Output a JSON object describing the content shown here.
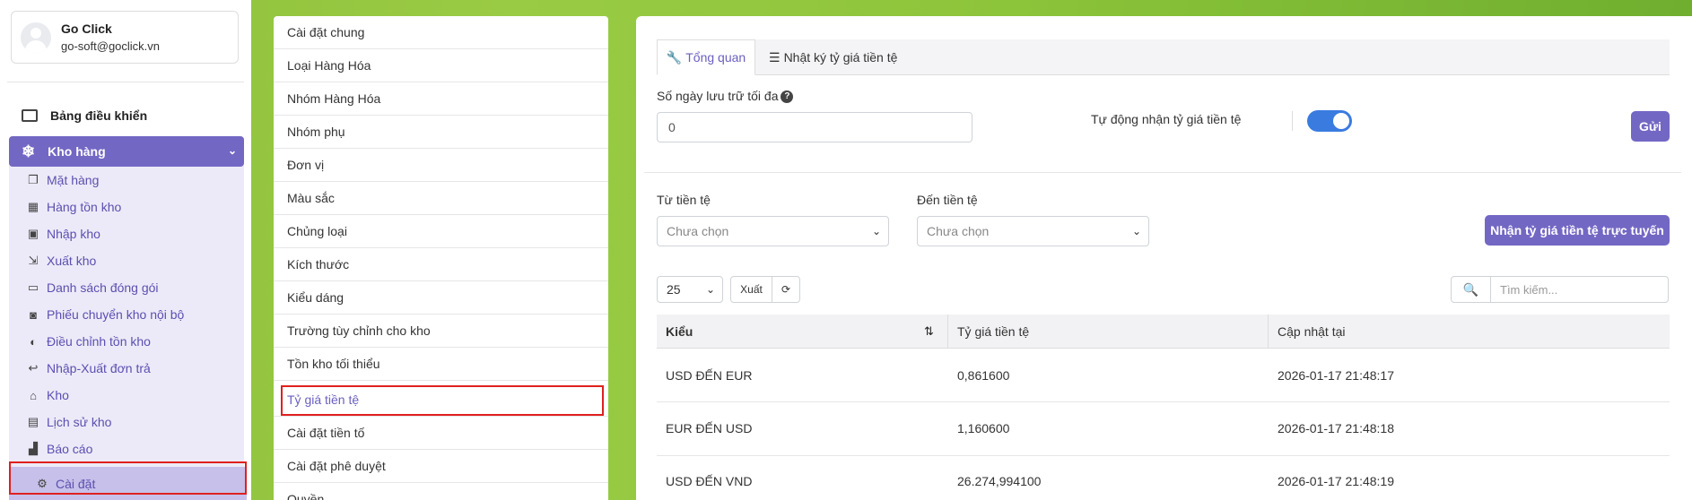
{
  "user": {
    "name": "Go Click",
    "email": "go-soft@goclick.vn"
  },
  "sidebar": {
    "dashboard": "Bảng điều khiển",
    "kho_hang": "Kho hàng",
    "items": [
      {
        "label": "Mặt hàng",
        "icon": "copy-icon"
      },
      {
        "label": "Hàng tồn kho",
        "icon": "boxes-icon"
      },
      {
        "label": "Nhập kho",
        "icon": "inbox-icon"
      },
      {
        "label": "Xuất kho",
        "icon": "export-icon"
      },
      {
        "label": "Danh sách đóng gói",
        "icon": "tray-icon"
      },
      {
        "label": "Phiếu chuyển kho nội bộ",
        "icon": "rss-icon"
      },
      {
        "label": "Điều chỉnh tồn kho",
        "icon": "half-circle-icon"
      },
      {
        "label": "Nhập-Xuất đơn trả",
        "icon": "reply-icon"
      },
      {
        "label": "Kho",
        "icon": "home-icon"
      },
      {
        "label": "Lịch sử kho",
        "icon": "calendar-icon"
      },
      {
        "label": "Báo cáo",
        "icon": "chart-icon"
      },
      {
        "label": "Cài đặt",
        "icon": "gears-icon"
      }
    ]
  },
  "settings_menu": [
    "Cài đặt chung",
    "Loại Hàng Hóa",
    "Nhóm Hàng Hóa",
    "Nhóm phụ",
    "Đơn vị",
    "Màu sắc",
    "Chủng loại",
    "Kích thước",
    "Kiểu dáng",
    "Trường tùy chỉnh cho kho",
    "Tồn kho tối thiểu",
    "Tỷ giá tiền tệ",
    "Cài đặt tiền tố",
    "Cài đặt phê duyệt",
    "Quyền"
  ],
  "tabs": {
    "overview": "Tổng quan",
    "log": "Nhật ký tỷ giá tiền tệ"
  },
  "form": {
    "max_days_label": "Số ngày lưu trữ tối đa",
    "max_days_value": "0",
    "auto_label": "Tự động nhận tỷ giá tiền tệ",
    "auto_enabled": true,
    "send_button": "Gửi",
    "from_label": "Từ tiền tệ",
    "to_label": "Đến tiền tệ",
    "from_placeholder": "Chưa chọn",
    "to_placeholder": "Chưa chọn",
    "fetch_button": "Nhận tỷ giá tiền tệ trực tuyến"
  },
  "table_controls": {
    "page_size": "25",
    "export": "Xuất",
    "search_placeholder": "Tìm kiếm..."
  },
  "table": {
    "headers": [
      "Kiểu",
      "Tỷ giá tiền tệ",
      "Cập nhật tại"
    ],
    "rows": [
      [
        "USD ĐẾN EUR",
        "0,861600",
        "2026-01-17 21:48:17"
      ],
      [
        "EUR ĐẾN USD",
        "1,160600",
        "2026-01-17 21:48:18"
      ],
      [
        "USD ĐẾN VND",
        "26.274,994100",
        "2026-01-17 21:48:19"
      ]
    ]
  },
  "colors": {
    "accent": "#7367c4",
    "highlight": "#e02020",
    "toggle": "#3a7be0"
  }
}
